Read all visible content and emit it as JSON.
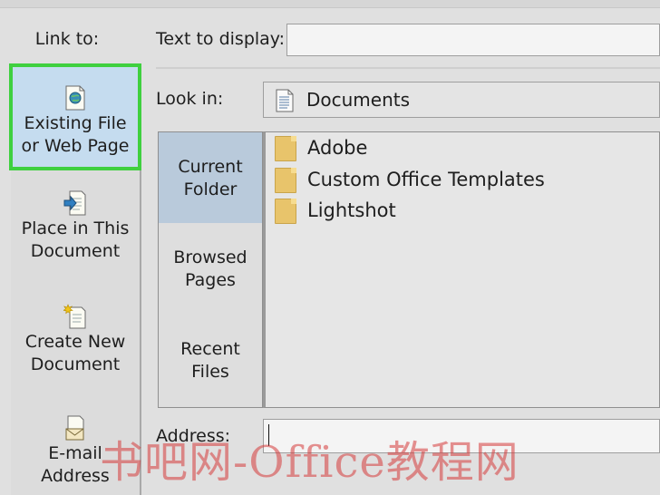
{
  "link_to": {
    "label": "Link to:",
    "items": [
      {
        "label": "Existing File\nor Web Page",
        "icon": "globe-document-icon",
        "selected": true
      },
      {
        "label": "Place in This\nDocument",
        "icon": "document-arrow-icon",
        "selected": false
      },
      {
        "label": "Create New\nDocument",
        "icon": "new-document-icon",
        "selected": false
      },
      {
        "label": "E-mail\nAddress",
        "icon": "email-icon",
        "selected": false
      }
    ]
  },
  "text_to_display": {
    "label": "Text to display:",
    "value": ""
  },
  "look_in": {
    "label": "Look in:",
    "value": "Documents",
    "icon": "documents-library-icon"
  },
  "tabs": [
    {
      "label": "Current\nFolder",
      "active": true
    },
    {
      "label": "Browsed\nPages",
      "active": false
    },
    {
      "label": "Recent\nFiles",
      "active": false
    }
  ],
  "files": [
    {
      "name": "Adobe",
      "icon": "folder-icon"
    },
    {
      "name": "Custom Office Templates",
      "icon": "folder-icon"
    },
    {
      "name": "Lightshot",
      "icon": "folder-icon"
    }
  ],
  "address": {
    "label": "Address:",
    "value": ""
  },
  "watermark": {
    "text": "书吧网-Office教程网"
  },
  "colors": {
    "selection_border": "#3fd03f",
    "selected_bg": "#c5dcef",
    "folder": "#e8c46b",
    "watermark": "#d63a3a"
  }
}
